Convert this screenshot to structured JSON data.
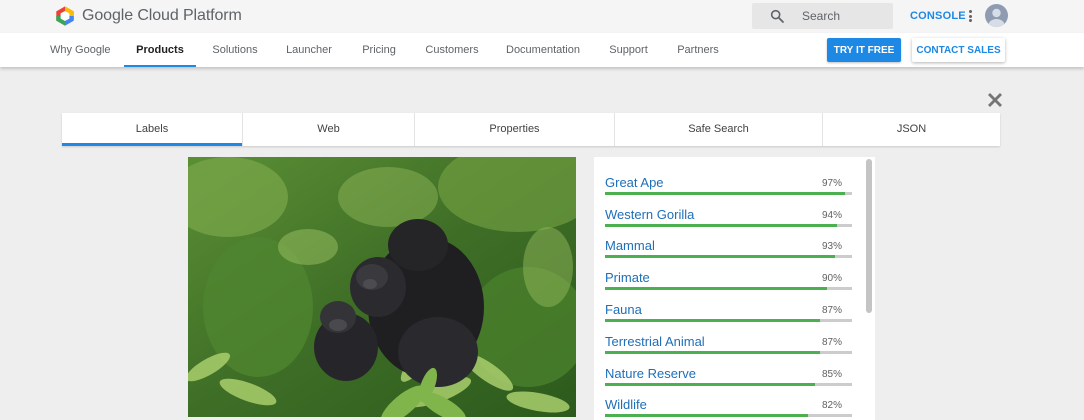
{
  "header": {
    "logo_text": "Google Cloud Platform",
    "search_placeholder": "Search",
    "console_label": "CONSOLE"
  },
  "nav": {
    "items": [
      {
        "label": "Why Google",
        "active": false
      },
      {
        "label": "Products",
        "active": true
      },
      {
        "label": "Solutions",
        "active": false
      },
      {
        "label": "Launcher",
        "active": false
      },
      {
        "label": "Pricing",
        "active": false
      },
      {
        "label": "Customers",
        "active": false
      },
      {
        "label": "Documentation",
        "active": false
      },
      {
        "label": "Support",
        "active": false
      },
      {
        "label": "Partners",
        "active": false
      }
    ],
    "try_label": "TRY IT FREE",
    "contact_label": "CONTACT SALES"
  },
  "tabs": [
    {
      "label": "Labels",
      "active": true
    },
    {
      "label": "Web",
      "active": false
    },
    {
      "label": "Properties",
      "active": false
    },
    {
      "label": "Safe Search",
      "active": false
    },
    {
      "label": "JSON",
      "active": false
    }
  ],
  "labels": [
    {
      "name": "Great Ape",
      "percent_text": "97%",
      "score": 0.97
    },
    {
      "name": "Western Gorilla",
      "percent_text": "94%",
      "score": 0.94
    },
    {
      "name": "Mammal",
      "percent_text": "93%",
      "score": 0.93
    },
    {
      "name": "Primate",
      "percent_text": "90%",
      "score": 0.9
    },
    {
      "name": "Fauna",
      "percent_text": "87%",
      "score": 0.87
    },
    {
      "name": "Terrestrial Animal",
      "percent_text": "87%",
      "score": 0.87
    },
    {
      "name": "Nature Reserve",
      "percent_text": "85%",
      "score": 0.85
    },
    {
      "name": "Wildlife",
      "percent_text": "82%",
      "score": 0.82
    }
  ],
  "colors": {
    "accent": "#1e88e5",
    "bar_fill": "#4caf50",
    "bar_track": "#cccccc",
    "label_text": "#1e6fb8"
  },
  "icons": {
    "logo": "cloud-hexagon-logo-icon",
    "search": "search-icon",
    "menu": "more-vert-icon",
    "close": "close-icon"
  }
}
